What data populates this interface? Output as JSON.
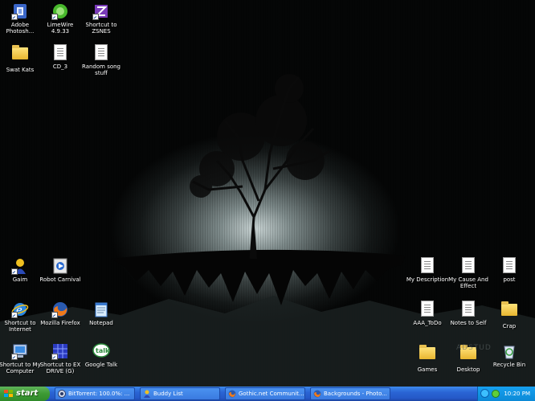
{
  "desktop": {
    "icons_left": [
      {
        "label": "Adobe Photosh...",
        "icon": "adobe-photoshop-icon"
      },
      {
        "label": "LimeWire 4.9.33",
        "icon": "limewire-icon"
      },
      {
        "label": "Shortcut to ZSNES",
        "icon": "zsnes-icon"
      },
      {
        "label": "Swat Kats",
        "icon": "folder-icon"
      },
      {
        "label": "CD_3",
        "icon": "document-icon"
      },
      {
        "label": "Random song stuff",
        "icon": "document-icon"
      },
      {
        "label": "Gaim",
        "icon": "gaim-icon"
      },
      {
        "label": "Robot Carnival",
        "icon": "video-file-icon"
      },
      {
        "label": "Shortcut to Internet",
        "icon": "internet-explorer-icon"
      },
      {
        "label": "Mozilla Firefox",
        "icon": "firefox-icon"
      },
      {
        "label": "Notepad",
        "icon": "notepad-icon"
      },
      {
        "label": "Shortcut to My Computer",
        "icon": "my-computer-icon"
      },
      {
        "label": "Shortcut to EX DRIVE (G)",
        "icon": "drive-icon"
      },
      {
        "label": "Google Talk",
        "icon": "google-talk-icon"
      }
    ],
    "icons_right": [
      {
        "label": "My Description",
        "icon": "document-icon"
      },
      {
        "label": "My Cause And Effect",
        "icon": "document-icon"
      },
      {
        "label": "post",
        "icon": "document-icon"
      },
      {
        "label": "AAA_ToDo",
        "icon": "document-icon"
      },
      {
        "label": "Notes to Self",
        "icon": "document-icon"
      },
      {
        "label": "Crap",
        "icon": "folder-icon"
      },
      {
        "label": "Games",
        "icon": "folder-icon"
      },
      {
        "label": "Desktop",
        "icon": "folder-icon"
      },
      {
        "label": "Recycle Bin",
        "icon": "recycle-bin-icon"
      }
    ],
    "watermark": "ADSTUD"
  },
  "taskbar": {
    "start_label": "start",
    "tasks": [
      {
        "label": "BitTorrent: 100.0%: ...",
        "icon": "bittorrent-icon"
      },
      {
        "label": "Buddy List",
        "icon": "gaim-icon"
      },
      {
        "label": "Gothic.net Communit...",
        "icon": "firefox-icon"
      },
      {
        "label": "Backgrounds - Photo...",
        "icon": "firefox-icon"
      }
    ],
    "clock": "10:20 PM"
  },
  "colors": {
    "taskbar": "#2a64d4",
    "start": "#3d9a34",
    "tray": "#0c8ad6"
  }
}
